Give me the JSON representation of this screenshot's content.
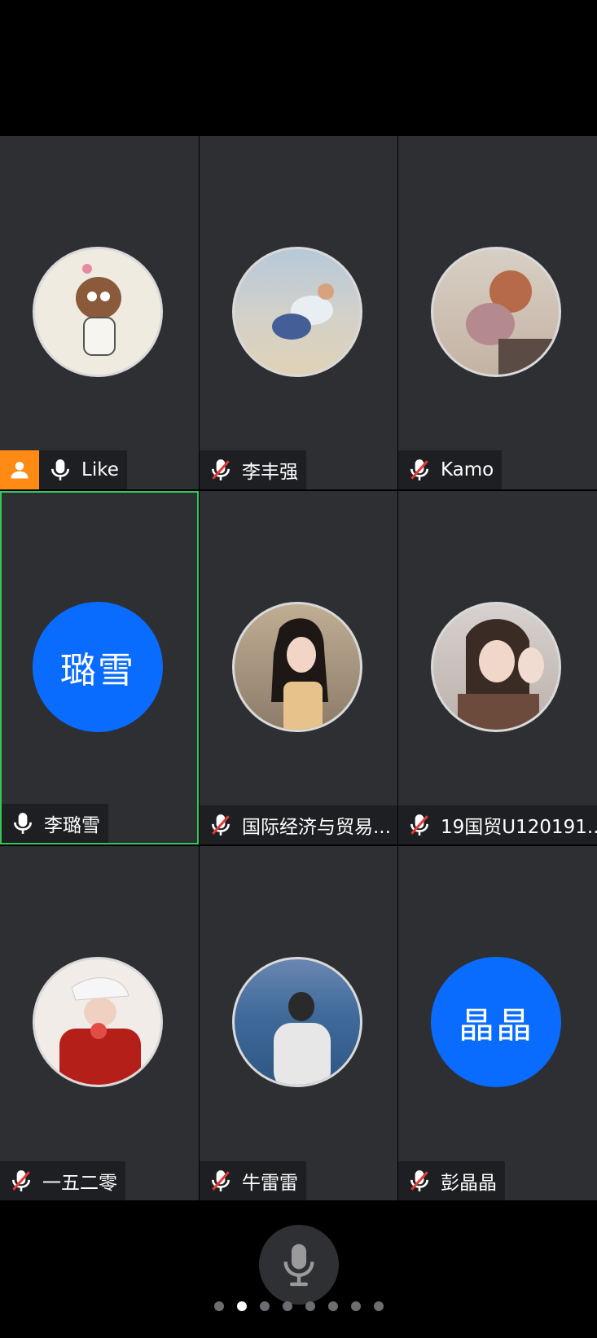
{
  "participants": [
    {
      "name": "Like",
      "host": true,
      "muted": false
    },
    {
      "name": "李丰强",
      "muted": true
    },
    {
      "name": "Kamo",
      "muted": true
    },
    {
      "name": "李璐雪",
      "muted": false,
      "active": true,
      "avatar_text": "璐雪"
    },
    {
      "name": "国际经济与贸易...",
      "muted": true
    },
    {
      "name": "19国贸U120191...",
      "muted": true
    },
    {
      "name": "一五二零",
      "muted": true
    },
    {
      "name": "牛雷雷",
      "muted": true
    },
    {
      "name": "彭晶晶",
      "muted": true,
      "avatar_text": "晶晶"
    }
  ],
  "controls": {
    "mic_icon": "mic-icon"
  },
  "pager": {
    "total": 8,
    "current": 2
  },
  "colors": {
    "host": "#ff8a14",
    "active_border": "#34c759",
    "avatar_blue": "#0a6cff",
    "tile": "#2d2f33"
  }
}
